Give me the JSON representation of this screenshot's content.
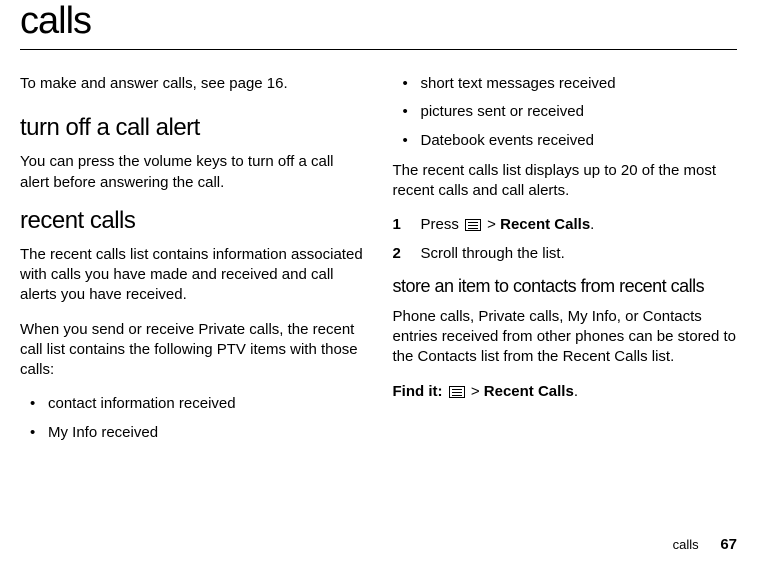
{
  "title": "calls",
  "left": {
    "intro": "To make and answer calls, see page 16.",
    "h2a": "turn off a call alert",
    "p1": "You can press the volume keys to turn off a call alert before answering the call.",
    "h2b": "recent calls",
    "p2": "The recent calls list contains information associated with calls you have made and received and call alerts you have received.",
    "p3": "When you send or receive Private calls, the recent call list contains the following PTV items with those calls:",
    "bullets": [
      "contact information received",
      "My Info received"
    ]
  },
  "right": {
    "bullets": [
      "short text messages received",
      "pictures sent or received",
      "Datebook events received"
    ],
    "p1": "The recent calls list displays up to 20 of the most recent calls and call alerts.",
    "step1_prefix": "Press ",
    "step1_gt": " > ",
    "step1_recent": "Recent Calls",
    "step2": "Scroll through the list.",
    "h3": "store an item to contacts from recent calls",
    "p2": "Phone calls, Private calls, My Info, or Contacts entries received from other phones can be stored to the Contacts list from the Recent Calls list.",
    "findit_label": "Find it: ",
    "findit_gt": " > ",
    "findit_recent": "Recent Calls"
  },
  "footer": {
    "section": "calls",
    "page": "67"
  }
}
